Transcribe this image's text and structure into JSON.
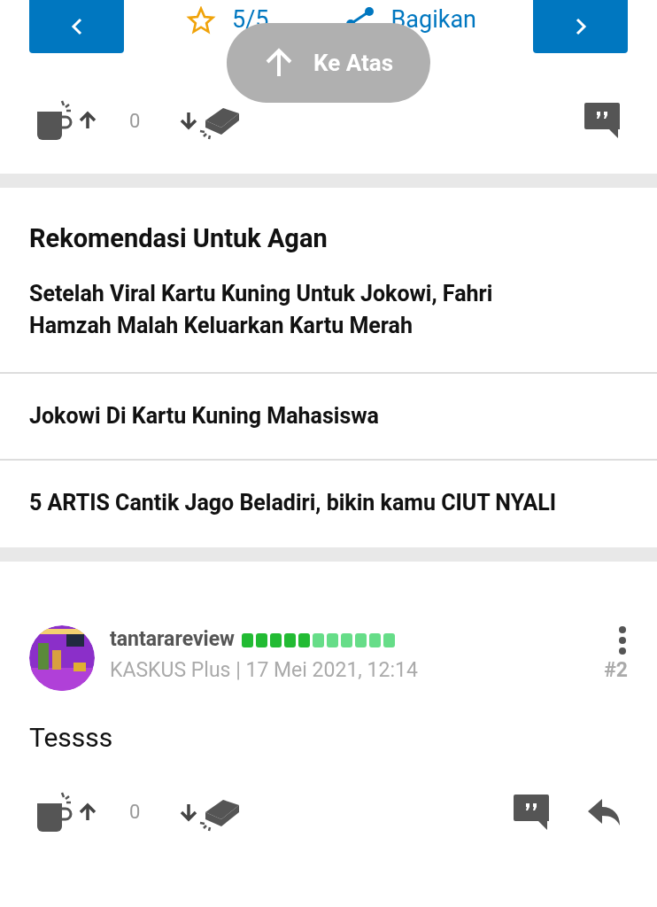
{
  "nav": {
    "rating": "5/5",
    "share": "Bagikan"
  },
  "back_to_top": {
    "label": "Ke Atas"
  },
  "first_post_actions": {
    "vote_count": "0"
  },
  "recommendations": {
    "title": "Rekomendasi Untuk Agan",
    "items": [
      {
        "title": "Setelah Viral Kartu Kuning Untuk Jokowi, Fahri Hamzah Malah Keluarkan Kartu Merah"
      },
      {
        "title": "Jokowi Di Kartu Kuning Mahasiswa"
      },
      {
        "title": "5 ARTIS Cantik Jago Beladiri, bikin kamu CIUT NYALI"
      }
    ]
  },
  "post": {
    "username": "tantarareview",
    "reputation": {
      "level": 0.45
    },
    "meta": "KASKUS Plus | 17 Mei 2021, 12:14",
    "number": "#2",
    "body": "Tessss",
    "vote_count": "0"
  }
}
